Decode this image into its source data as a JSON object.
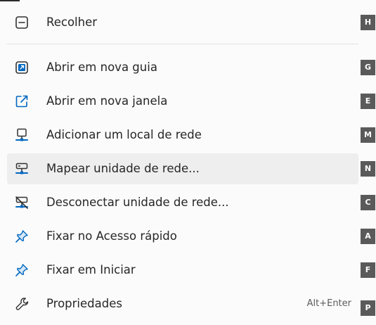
{
  "menu": {
    "items": [
      {
        "label": "Recolher",
        "icon": "collapse-icon",
        "key": "H"
      },
      {
        "label": "Abrir em nova guia",
        "icon": "open-new-tab-icon",
        "key": "G"
      },
      {
        "label": "Abrir em nova janela",
        "icon": "open-new-window-icon",
        "key": "E"
      },
      {
        "label": "Adicionar um local de rede",
        "icon": "add-network-location-icon",
        "key": "M"
      },
      {
        "label": "Mapear unidade de rede...",
        "icon": "map-network-drive-icon",
        "key": "N"
      },
      {
        "label": "Desconectar unidade de rede...",
        "icon": "disconnect-network-drive-icon",
        "key": "C"
      },
      {
        "label": "Fixar no Acesso rápido",
        "icon": "pin-icon",
        "key": "A"
      },
      {
        "label": "Fixar em Iniciar",
        "icon": "pin-icon",
        "key": "F"
      },
      {
        "label": "Propriedades",
        "icon": "wrench-icon",
        "key": "P",
        "shortcut": "Alt+Enter"
      }
    ]
  },
  "colors": {
    "accent": "#0067c0",
    "text": "#262626",
    "key_badge": "#5a5a5a",
    "highlight": "#eeeeee"
  }
}
